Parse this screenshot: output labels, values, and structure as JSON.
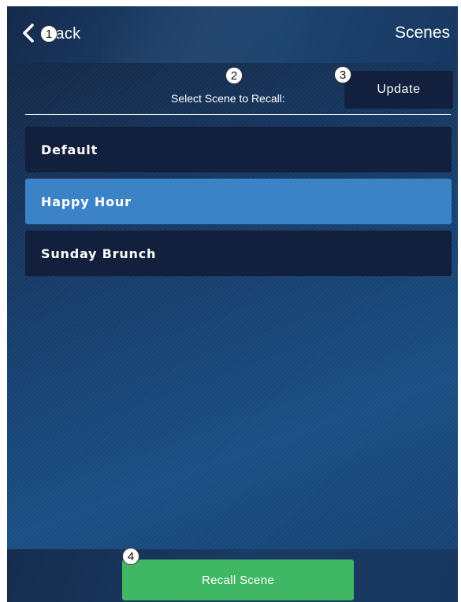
{
  "header": {
    "back_label": "Back",
    "title": "Scenes"
  },
  "callouts": [
    "1",
    "2",
    "3",
    "4"
  ],
  "prompt": "Select Scene to Recall:",
  "update_label": "Update",
  "scenes": [
    {
      "label": "Default",
      "selected": false
    },
    {
      "label": "Happy Hour",
      "selected": true
    },
    {
      "label": "Sunday Brunch",
      "selected": false
    }
  ],
  "footer": {
    "recall_label": "Recall Scene"
  },
  "colors": {
    "item_bg": "#121f3d",
    "selected_bg": "#3b82c6",
    "recall_bg": "#3fb765"
  },
  "icons": {
    "back": "chevron-left-icon"
  }
}
